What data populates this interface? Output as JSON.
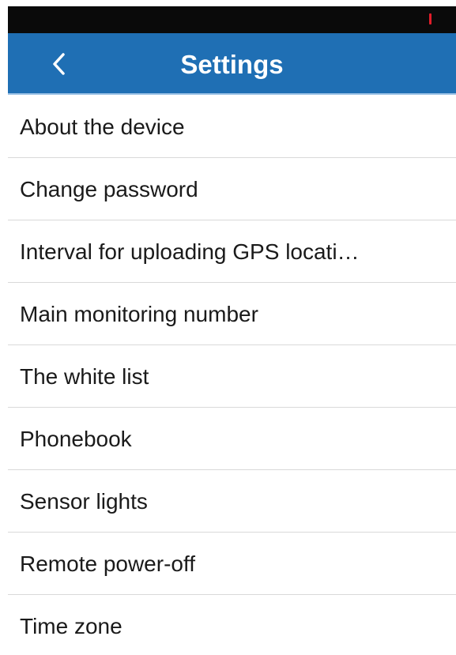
{
  "nav": {
    "title": "Settings"
  },
  "settings": {
    "items": [
      {
        "label": "About the device"
      },
      {
        "label": "Change password"
      },
      {
        "label": "Interval for uploading GPS locati…"
      },
      {
        "label": "Main monitoring number"
      },
      {
        "label": "The white list"
      },
      {
        "label": "Phonebook"
      },
      {
        "label": "Sensor lights"
      },
      {
        "label": "Remote power-off"
      },
      {
        "label": "Time zone"
      }
    ]
  },
  "icons": {
    "back": "chevron-left-icon",
    "battery": "battery-icon"
  },
  "colors": {
    "nav_background": "#1f6fb4",
    "status_bar": "#0a0a0a",
    "battery_low": "#e11d2a",
    "divider": "#d9d9d9"
  }
}
